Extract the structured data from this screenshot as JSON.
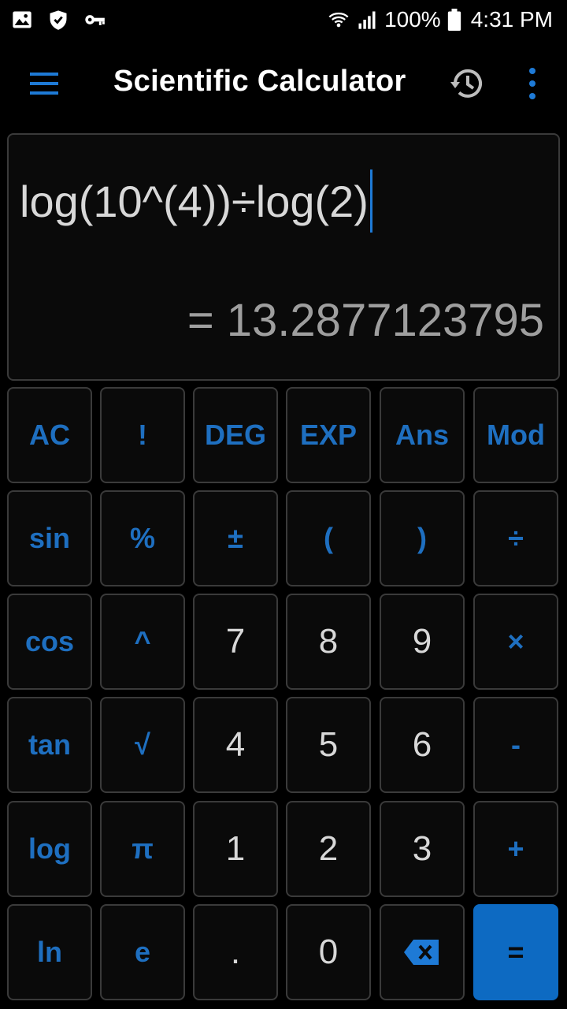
{
  "status_bar": {
    "battery": "100%",
    "time": "4:31 PM",
    "icons": [
      "image-icon",
      "shield-icon",
      "key-icon",
      "wifi-icon",
      "signal-icon",
      "battery-icon"
    ]
  },
  "app_bar": {
    "title": "Scientific Calculator",
    "icons": [
      "menu-icon",
      "history-icon",
      "more-vert-icon"
    ]
  },
  "display": {
    "expression": "log(10^(4))÷log(2)",
    "result": "= 13.2877123795"
  },
  "colors": {
    "accent": "#1e6fc0",
    "equals_bg": "#0d6ac2",
    "caret": "#1e7ad6",
    "key_border": "#3a3a3a",
    "result_text": "#9e9e9e"
  },
  "keys": {
    "ac": "AC",
    "factorial": "!",
    "deg": "DEG",
    "exp": "EXP",
    "ans": "Ans",
    "mod": "Mod",
    "sin": "sin",
    "percent": "%",
    "plus_minus": "±",
    "open_paren": "(",
    "close_paren": ")",
    "divide": "÷",
    "cos": "cos",
    "power": "^",
    "seven": "7",
    "eight": "8",
    "nine": "9",
    "multiply": "×",
    "tan": "tan",
    "sqrt": "√",
    "four": "4",
    "five": "5",
    "six": "6",
    "minus": "-",
    "log": "log",
    "pi": "π",
    "one": "1",
    "two": "2",
    "three": "3",
    "plus": "+",
    "ln": "ln",
    "e": "e",
    "dot": ".",
    "zero": "0",
    "backspace_icon": "backspace-icon",
    "equals": "="
  }
}
